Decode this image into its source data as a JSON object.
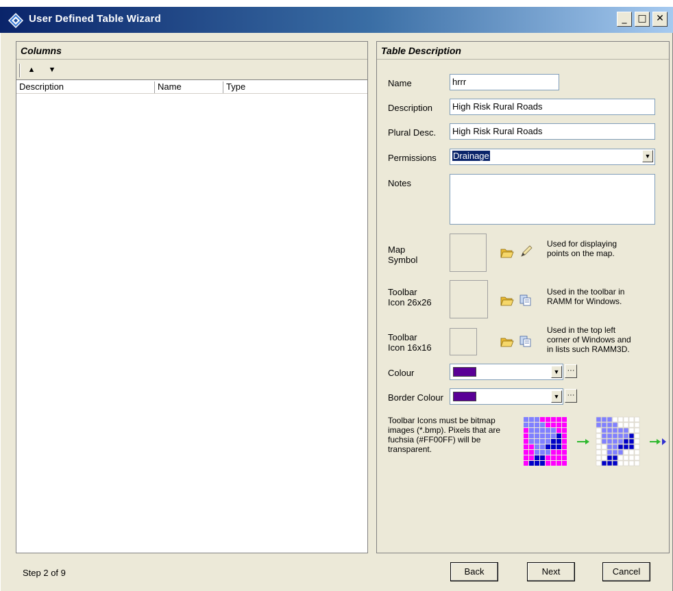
{
  "window": {
    "title": "User Defined Table Wizard",
    "minimize_glyph": "_",
    "maximize_glyph": "□",
    "close_glyph": "✕"
  },
  "columns_panel": {
    "title": "Columns",
    "move_up_glyph": "▲",
    "move_down_glyph": "▼",
    "headers": [
      "Description",
      "Name",
      "Type"
    ]
  },
  "table_description": {
    "title": "Table Description",
    "name_label": "Name",
    "name_value": "hrrr",
    "description_label": "Description",
    "description_value": "High Risk Rural Roads",
    "plural_label": "Plural Desc.",
    "plural_value": "High Risk Rural Roads",
    "permissions_label": "Permissions",
    "permissions_value": "Drainage",
    "notes_label": "Notes",
    "notes_value": "",
    "map_symbol_label_1": "Map",
    "map_symbol_label_2": "Symbol",
    "map_symbol_hint_1": "Used for displaying",
    "map_symbol_hint_2": "points on the map.",
    "icon26_label_1": "Toolbar",
    "icon26_label_2": "Icon 26x26",
    "icon26_hint_1": "Used in the toolbar in",
    "icon26_hint_2": "RAMM for Windows.",
    "icon16_label_1": "Toolbar",
    "icon16_label_2": "Icon 16x16",
    "icon16_hint_1": "Used in the top left",
    "icon16_hint_2": "corner of Windows and",
    "icon16_hint_3": "in lists such RAMM3D.",
    "colour_label": "Colour",
    "colour_value": "#5a0096",
    "border_colour_label": "Border Colour",
    "border_colour_value": "#5a0096",
    "ellipsis_glyph": "···",
    "dropdown_glyph": "▼",
    "info_1": "Toolbar Icons must be bitmap",
    "info_2": "images (*.bmp). Pixels that are",
    "info_3": "fuchsia (#FF00FF) will be",
    "info_4": "transparent."
  },
  "footer": {
    "step_text": "Step 2 of 9",
    "back_label": "Back",
    "next_label": "Next",
    "cancel_label": "Cancel"
  },
  "colors": {
    "fuchsia": "#ff00ff",
    "dark_blue": "#0000c8",
    "light_blue": "#8080ff",
    "grid": "#d4d0c8",
    "green_arrow": "#2db82d"
  }
}
